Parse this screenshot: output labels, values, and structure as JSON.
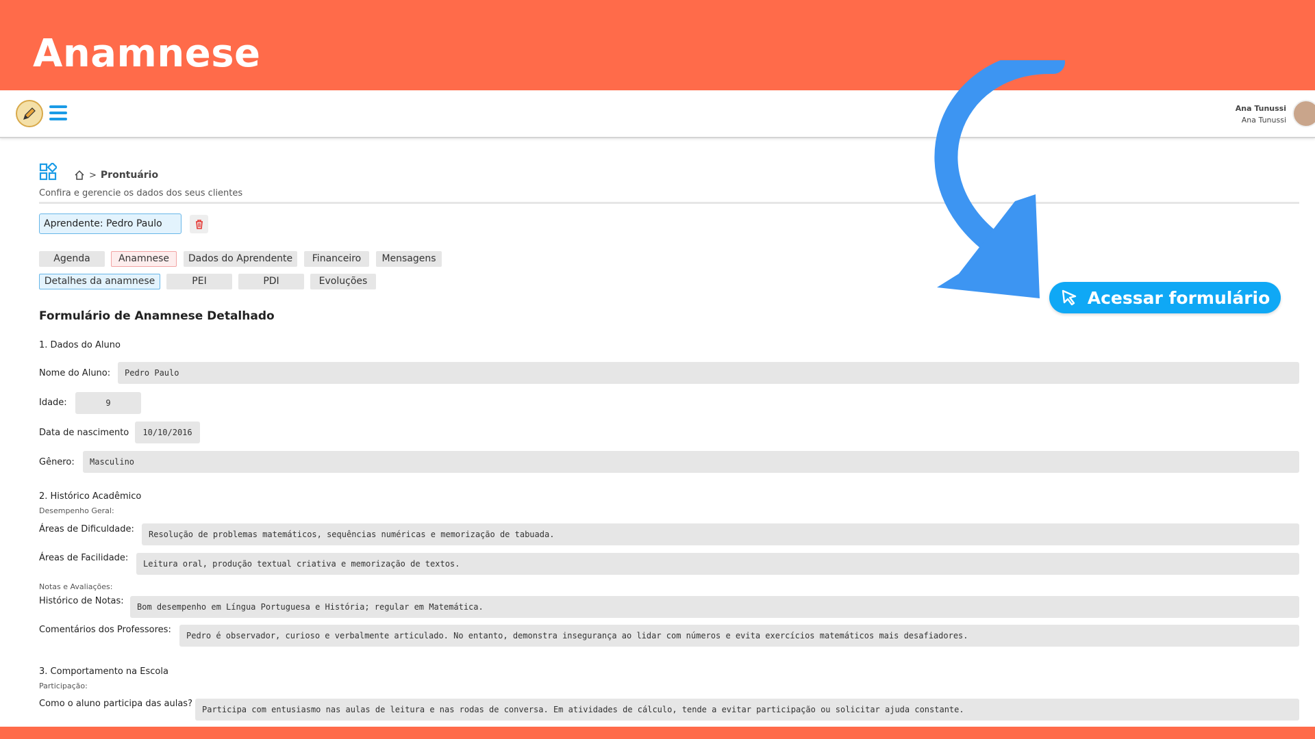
{
  "banner": {
    "title": "Anamnese"
  },
  "header": {
    "user_name": "Ana Tunussi",
    "user_subtitle": "Ana Tunussi"
  },
  "breadcrumb": {
    "current": "Prontuário",
    "subtitle": "Confira e gerencie os dados dos seus clientes"
  },
  "learner": {
    "label": "Aprendente: Pedro Paulo"
  },
  "tabs_row1": [
    "Agenda",
    "Anamnese",
    "Dados do Aprendente",
    "Financeiro",
    "Mensagens"
  ],
  "tabs_row2": [
    "Detalhes da anamnese",
    "PEI",
    "PDI",
    "Evoluções"
  ],
  "cta": {
    "label": "Acessar formulário",
    "color": "#0FA8F5"
  },
  "form": {
    "title": "Formulário de Anamnese Detalhado",
    "section1": {
      "title": "1. Dados do Aluno",
      "nome_label": "Nome do Aluno:",
      "nome_value": "Pedro Paulo",
      "idade_label": "Idade:",
      "idade_value": "9",
      "nascimento_label": "Data de nascimento",
      "nascimento_value": "10/10/2016",
      "genero_label": "Gênero:",
      "genero_value": "Masculino"
    },
    "section2": {
      "title": "2. Histórico Acadêmico",
      "sub1": "Desempenho Geral:",
      "dificuldade_label": "Áreas de Dificuldade:",
      "dificuldade_value": "Resolução de problemas matemáticos, sequências numéricas e memorização de tabuada.",
      "facilidade_label": "Áreas de Facilidade:",
      "facilidade_value": "Leitura oral, produção textual criativa e memorização de textos.",
      "sub2": "Notas e Avaliações:",
      "notas_label": "Histórico de Notas:",
      "notas_value": "Bom desempenho em Língua Portuguesa e História; regular em Matemática.",
      "comentarios_label": "Comentários dos Professores:",
      "comentarios_value": "Pedro é observador, curioso e verbalmente articulado. No entanto, demonstra insegurança ao lidar com números e evita exercícios matemáticos mais desafiadores."
    },
    "section3": {
      "title": "3. Comportamento na Escola",
      "sub1": "Participação:",
      "participa_label": "Como o aluno participa das aulas?",
      "participa_value": "Participa com entusiasmo nas aulas de leitura e nas rodas de conversa. Em atividades de cálculo, tende a evitar participação ou solicitar ajuda constante."
    }
  },
  "colors": {
    "banner": "#FF6B4A",
    "accent": "#1A9BE6",
    "arrow": "#3D95F2"
  }
}
